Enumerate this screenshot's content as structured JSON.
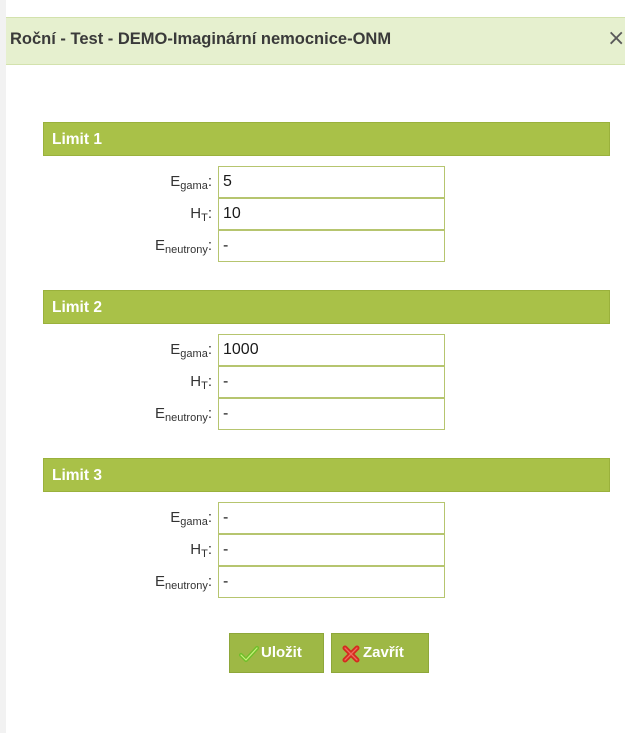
{
  "dialog": {
    "title": "Roční - Test - DEMO-Imaginární nemocnice-ONM",
    "close_glyph": "×"
  },
  "limits": [
    {
      "heading": "Limit 1",
      "fields": [
        {
          "label_main": "E",
          "label_sub": "gama",
          "label_suffix": ":",
          "value": "5"
        },
        {
          "label_main": "H",
          "label_sub": "T",
          "label_suffix": ":",
          "value": "10"
        },
        {
          "label_main": "E",
          "label_sub": "neutrony",
          "label_suffix": ":",
          "value": "-"
        }
      ]
    },
    {
      "heading": "Limit 2",
      "fields": [
        {
          "label_main": "E",
          "label_sub": "gama",
          "label_suffix": ":",
          "value": "1000"
        },
        {
          "label_main": "H",
          "label_sub": "T",
          "label_suffix": ":",
          "value": "-"
        },
        {
          "label_main": "E",
          "label_sub": "neutrony",
          "label_suffix": ":",
          "value": "-"
        }
      ]
    },
    {
      "heading": "Limit 3",
      "fields": [
        {
          "label_main": "E",
          "label_sub": "gama",
          "label_suffix": ":",
          "value": "-"
        },
        {
          "label_main": "H",
          "label_sub": "T",
          "label_suffix": ":",
          "value": "-"
        },
        {
          "label_main": "E",
          "label_sub": "neutrony",
          "label_suffix": ":",
          "value": "-"
        }
      ]
    }
  ],
  "actions": {
    "save_label": "Uložit",
    "close_label": "Zavřít",
    "save_icon": "checkmark-icon",
    "close_icon": "cross-icon"
  },
  "colors": {
    "header_bg": "#e6f0cf",
    "section_bg": "#a9c148",
    "button_bg": "#9eb845",
    "check_green": "#6fbf2a",
    "cross_red": "#d42b1e"
  }
}
